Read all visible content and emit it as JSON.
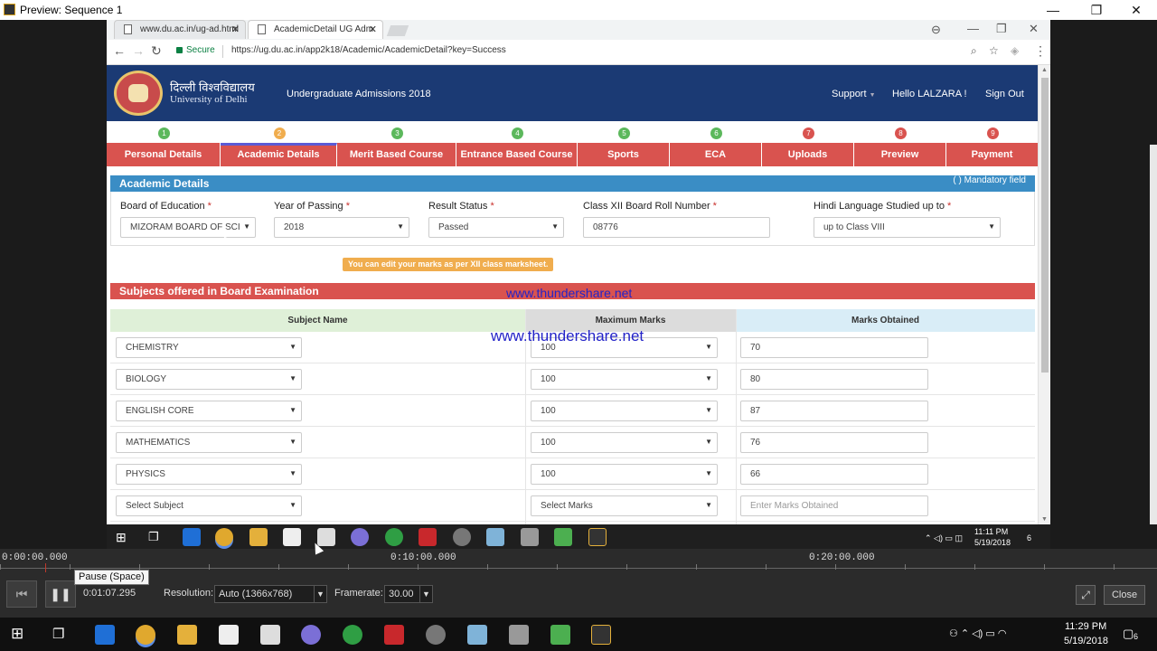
{
  "preview_window": {
    "title": "Preview: Sequence 1",
    "buttons": [
      "—",
      "❐",
      "✕"
    ]
  },
  "browser": {
    "tabs": [
      {
        "label": "www.du.ac.in/ug-ad.html",
        "active": false
      },
      {
        "label": "AcademicDetail UG Adm",
        "active": true
      }
    ],
    "secure_label": "Secure",
    "url": "https://ug.du.ac.in/app2k18/Academic/AcademicDetail?key=Success",
    "controls": {
      "profile": "⊖",
      "minimize": "—",
      "restore": "❐",
      "close": "✕"
    }
  },
  "site_header": {
    "hindi_name": "दिल्ली विश्वविद्यालय",
    "english_name": "University of Delhi",
    "title": "Undergraduate Admissions 2018",
    "support": "Support",
    "greeting": "Hello LALZARA !",
    "signout": "Sign Out"
  },
  "steps": [
    {
      "num": "1",
      "label": "Personal Details",
      "color": "#5cb85c"
    },
    {
      "num": "2",
      "label": "Academic Details",
      "color": "#f0ad4e",
      "active": true
    },
    {
      "num": "3",
      "label": "Merit Based Course",
      "color": "#5cb85c"
    },
    {
      "num": "4",
      "label": "Entrance Based Course",
      "color": "#5cb85c"
    },
    {
      "num": "5",
      "label": "Sports",
      "color": "#5cb85c"
    },
    {
      "num": "6",
      "label": "ECA",
      "color": "#5cb85c"
    },
    {
      "num": "7",
      "label": "Uploads",
      "color": "#d9534f"
    },
    {
      "num": "8",
      "label": "Preview",
      "color": "#d9534f"
    },
    {
      "num": "9",
      "label": "Payment",
      "color": "#d9534f"
    }
  ],
  "academic": {
    "section_title": "Academic Details",
    "mandatory_note": "( ) Mandatory field",
    "fields": {
      "board": {
        "label": "Board of Education",
        "value": "MIZORAM BOARD OF SCI"
      },
      "year": {
        "label": "Year of Passing",
        "value": "2018"
      },
      "result": {
        "label": "Result Status",
        "value": "Passed"
      },
      "roll": {
        "label": "Class XII Board Roll Number",
        "value": "08776"
      },
      "hindi": {
        "label": "Hindi Language Studied up to",
        "value": "up to Class VIII"
      }
    },
    "edit_note": "You can edit your marks as per XII class marksheet."
  },
  "subjects": {
    "section_title": "Subjects offered in Board Examination",
    "columns": [
      "Subject Name",
      "Maximum Marks",
      "Marks Obtained"
    ],
    "rows": [
      {
        "subject": "CHEMISTRY",
        "max": "100",
        "obtained": "70"
      },
      {
        "subject": "BIOLOGY",
        "max": "100",
        "obtained": "80"
      },
      {
        "subject": "ENGLISH CORE",
        "max": "100",
        "obtained": "87"
      },
      {
        "subject": "MATHEMATICS",
        "max": "100",
        "obtained": "76"
      },
      {
        "subject": "PHYSICS",
        "max": "100",
        "obtained": "66"
      },
      {
        "subject": "Select Subject",
        "max": "Select Marks",
        "obtained": "Enter Marks Obtained",
        "placeholder": true
      }
    ]
  },
  "watermark": "www.thundershare.net",
  "video_taskbar": {
    "time": "11:11 PM",
    "date": "5/19/2018",
    "badge": "6"
  },
  "timeline": {
    "labels": [
      "0:00:00.000",
      "0:10:00.000",
      "0:20:00.000"
    ]
  },
  "player": {
    "current_time": "0:01:07.295",
    "resolution_label": "Resolution:",
    "resolution_value": "Auto (1366x768)",
    "framerate_label": "Framerate:",
    "framerate_value": "30.00",
    "tooltip": "Pause (Space)",
    "close": "Close"
  },
  "os_taskbar": {
    "time": "11:29 PM",
    "date": "5/19/2018",
    "badge": "6"
  }
}
